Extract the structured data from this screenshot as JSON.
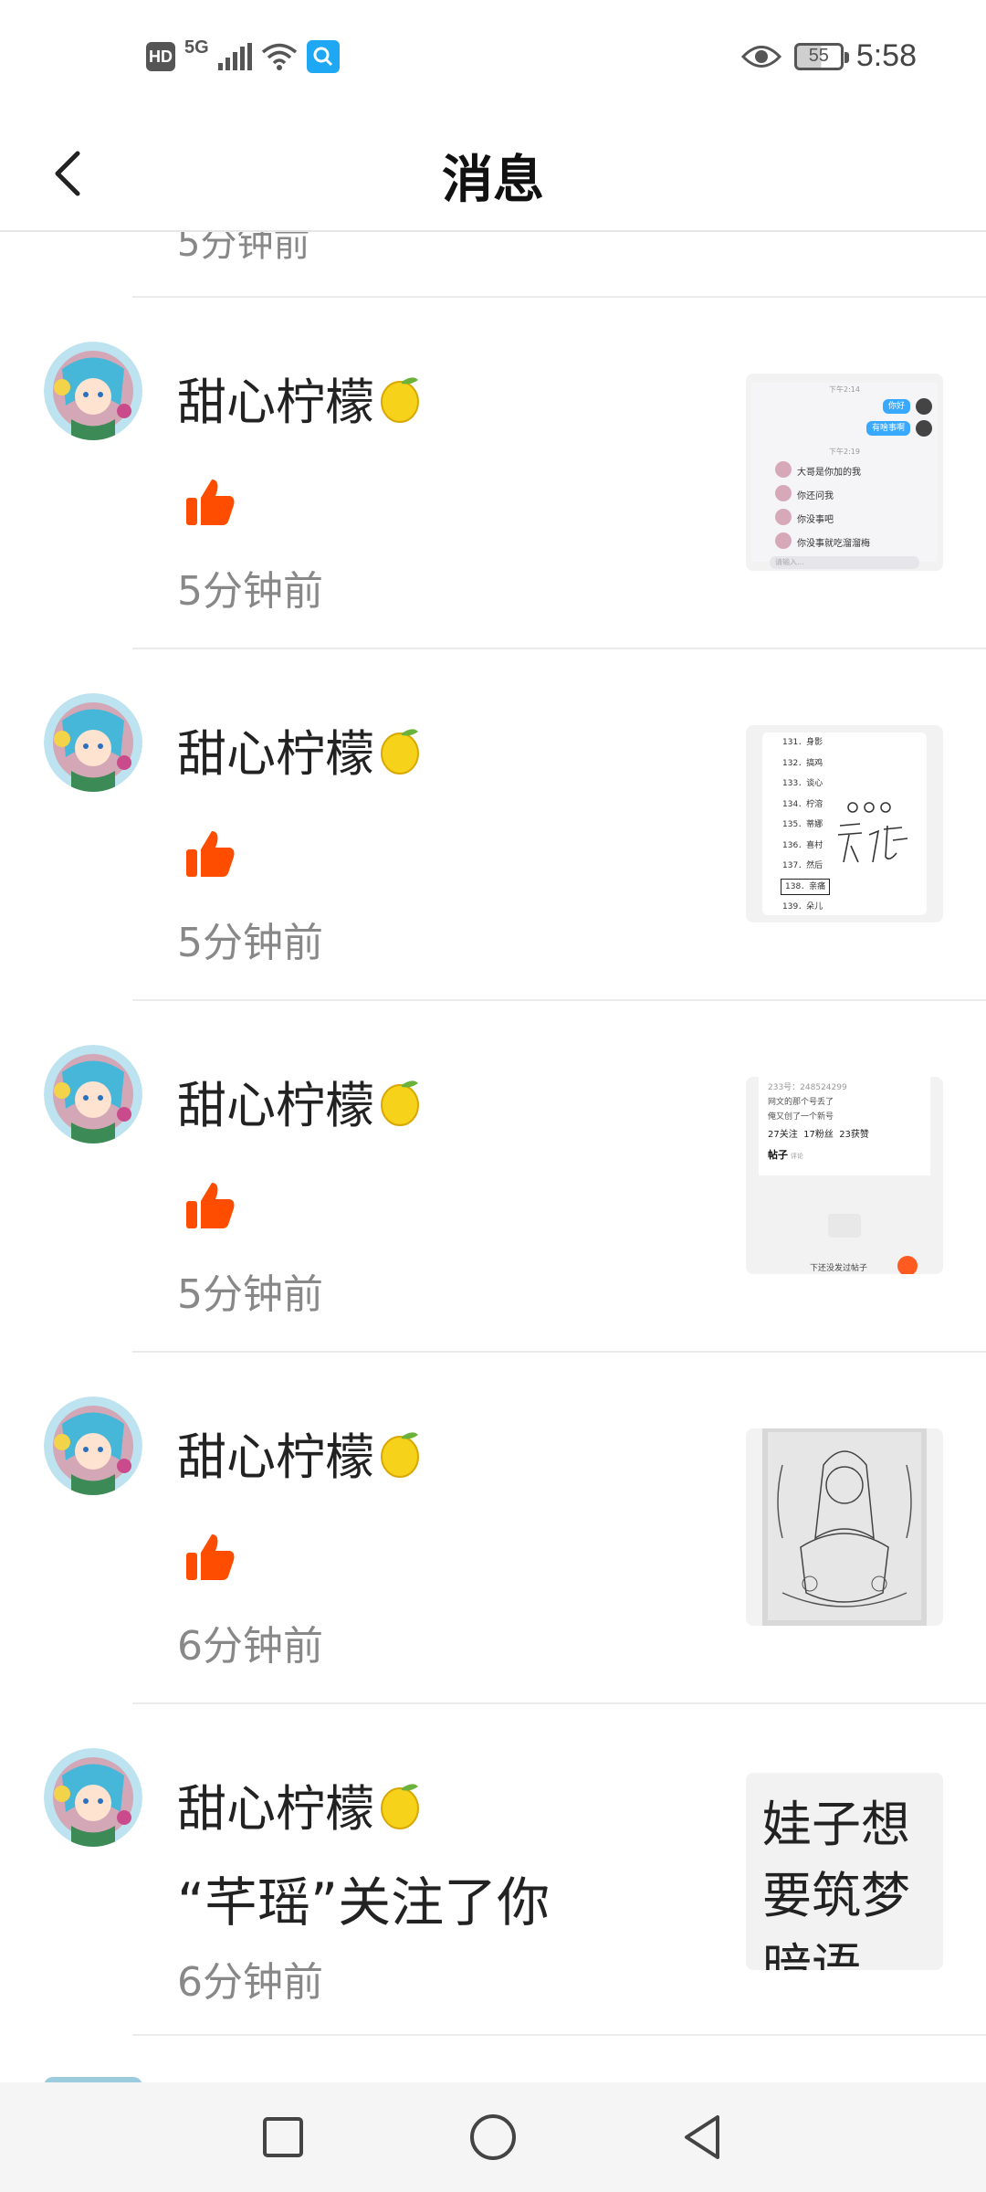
{
  "status_bar": {
    "hd": "HD",
    "network": "5G",
    "battery": "55",
    "time": "5:58"
  },
  "header": {
    "title": "消息"
  },
  "first_partial_time": "5分钟前",
  "items": [
    {
      "name": "甜心柠檬",
      "type": "like",
      "time": "5分钟前",
      "thumb": {
        "kind": "chat",
        "lines": [
          "你好",
          "有啥事啊",
          "大哥是你加的我",
          "你还问我",
          "你没事吧",
          "你没事就吃溜溜梅"
        ],
        "times": [
          "下午2:14",
          "下午2:19"
        ],
        "input": "请输入..."
      }
    },
    {
      "name": "甜心柠檬",
      "type": "like",
      "time": "5分钟前",
      "thumb": {
        "kind": "list",
        "rows": [
          "131．身影",
          "132．搞鸡",
          "133．谈心",
          "134．柠溶",
          "135．蒂娜",
          "136．喜村",
          "137．然后",
          "138．亲痛",
          "139．朵儿"
        ],
        "scribble": "ooo 无语"
      }
    },
    {
      "name": "甜心柠檬",
      "type": "like",
      "time": "5分钟前",
      "thumb": {
        "kind": "profile",
        "id": "233号：248524299",
        "bio1": "网文的那个号丢了",
        "bio2": "俺又创了一个新号",
        "stats": [
          "27关注",
          "17粉丝",
          "23获赞"
        ],
        "tab": "帖子",
        "tab2": "评论",
        "bottom": "下还没发过帖子"
      }
    },
    {
      "name": "甜心柠檬",
      "type": "like",
      "time": "6分钟前",
      "thumb": {
        "kind": "sketch"
      }
    },
    {
      "name": "甜心柠檬",
      "type": "follow",
      "time": "6分钟前",
      "message": "“芊瑶”关注了你",
      "thumb": {
        "kind": "text",
        "text": "娃子想要筑梦暗语"
      }
    }
  ],
  "icons": {
    "back": "chevron-left-icon",
    "like": "thumbs-up-icon",
    "lemon": "lemon-emoji-icon"
  },
  "colors": {
    "like": "#ff4d00",
    "time": "#888888",
    "accent_blue": "#1ea7f3"
  }
}
